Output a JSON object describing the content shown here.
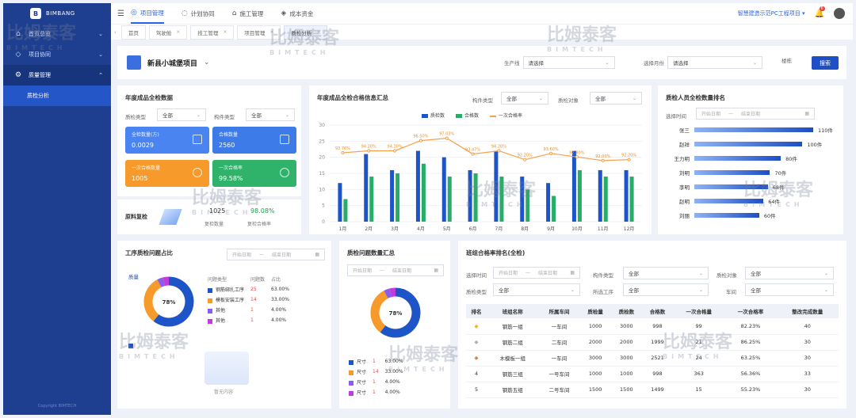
{
  "sidebar": {
    "logo": "BIMBANG",
    "items": [
      {
        "label": "首页总览",
        "icon": "home-icon"
      },
      {
        "label": "项目协同",
        "icon": "collab-icon"
      },
      {
        "label": "质量管理",
        "icon": "gear-icon"
      }
    ],
    "sub_items": [
      {
        "label": "质检分析"
      }
    ],
    "footer": "Copyright BIMTECH"
  },
  "topbar": {
    "nav": [
      {
        "label": "项目管理",
        "icon": "project-icon",
        "active": true
      },
      {
        "label": "计划协同",
        "icon": "plan-icon",
        "active": false
      },
      {
        "label": "施工管理",
        "icon": "construction-icon",
        "active": false
      },
      {
        "label": "成本资金",
        "icon": "cost-icon",
        "active": false
      }
    ],
    "project_selector": "智慧建造示范PC工程项目 ▾",
    "notification_count": "6"
  },
  "tabs": [
    {
      "label": "首页",
      "active": false
    },
    {
      "label": "驾驶舱",
      "active": false
    },
    {
      "label": "技工管理",
      "active": false
    },
    {
      "label": "项目管理",
      "active": false
    },
    {
      "label": "质检分析",
      "active": true
    }
  ],
  "filter": {
    "project_title": "新县小城堡项目",
    "field1_label": "生产线",
    "field1_value": "请选择",
    "field2_label": "选择月份",
    "field2_value": "请选择",
    "field3_label": "楼栋",
    "search_label": "搜索"
  },
  "annual": {
    "title": "年度成品全检数据",
    "f1_label": "质检类型",
    "f1_value": "全部",
    "f2_label": "构件类型",
    "f2_value": "全部",
    "kpis": [
      {
        "label": "全检数量(方)",
        "value": "0.0029",
        "color": "#4a84f0"
      },
      {
        "label": "合格数量",
        "value": "2560",
        "color": "#3d7be8"
      },
      {
        "label": "一次合格数量",
        "value": "1005",
        "color": "#f59a2b"
      },
      {
        "label": "一次合格率",
        "value": "99.58%",
        "color": "#2fb36a"
      }
    ],
    "raw_label": "原料复检",
    "raw_count": "1025",
    "raw_count_label": "复检数量",
    "raw_rate": "98.08%",
    "raw_rate_label": "复检合格率"
  },
  "combo": {
    "title": "年度成品全检合格信息汇总",
    "f1_label": "构件类型",
    "f1_value": "全部",
    "f2_label": "质检对象",
    "f2_value": "全部"
  },
  "chart_data": {
    "type": "bar",
    "categories": [
      "1月",
      "2月",
      "3月",
      "4月",
      "5月",
      "6月",
      "7月",
      "8月",
      "9月",
      "10月",
      "11月",
      "12月"
    ],
    "series": [
      {
        "name": "质检数",
        "values": [
          12,
          21,
          16,
          22,
          20,
          16,
          22,
          14,
          12,
          22,
          16,
          16
        ],
        "color": "#1d54c7"
      },
      {
        "name": "合格数",
        "values": [
          7,
          14,
          15,
          18,
          14,
          15,
          14,
          10,
          8,
          16,
          14,
          14
        ],
        "color": "#27ad67"
      },
      {
        "name": "一次合格率",
        "values": [
          93.76,
          94.2,
          94.2,
          96.5,
          97.03,
          93.47,
          94.2,
          92.2,
          93.6,
          92.8,
          92,
          92.2
        ],
        "color": "#f4a04a"
      }
    ],
    "point_labels": [
      "93.76%",
      "94.20%",
      "94.20%",
      "96.50%",
      "97.03%",
      "93.47%",
      "94.20%",
      "92.20%",
      "93.60%",
      "92.80%",
      "92.00%",
      "92.20%"
    ],
    "yticks": [
      "0",
      "5",
      "10",
      "15",
      "20",
      "25",
      "30"
    ],
    "ylim": [
      0,
      30
    ],
    "rate_range": [
      80,
      100
    ],
    "legend": "top"
  },
  "personnel": {
    "title": "质检人员全检数量排名",
    "date_label": "选择时间",
    "date_start": "开始日期",
    "date_end": "结束日期",
    "rows": [
      {
        "name": "张三",
        "value": 110,
        "label": "110件"
      },
      {
        "name": "赵祥",
        "value": 100,
        "label": "100件"
      },
      {
        "name": "王力明",
        "value": 80,
        "label": "80件"
      },
      {
        "name": "刘明",
        "value": 70,
        "label": "70件"
      },
      {
        "name": "李明",
        "value": 68,
        "label": "68件"
      },
      {
        "name": "赵明",
        "value": 64,
        "label": "64件"
      },
      {
        "name": "刘丽",
        "value": 60,
        "label": "60件"
      }
    ]
  },
  "process": {
    "title": "工序质检问题占比",
    "date_start": "开始日期",
    "date_end": "结束日期",
    "donut_label": "质量",
    "donut_center": "78%",
    "headers": [
      "问题类型",
      "问题数",
      "占比"
    ],
    "rows": [
      {
        "name": "钢筋绑扎工序",
        "count": "25",
        "pct": "63.00%",
        "value": 63,
        "color": "#1d54c7"
      },
      {
        "name": "模板安装工序",
        "count": "14",
        "pct": "33.00%",
        "value": 33,
        "color": "#f59a2b"
      },
      {
        "name": "其他",
        "count": "1",
        "pct": "4.00%",
        "value": 4,
        "color": "#8a5cf0"
      },
      {
        "name": "其他",
        "count": "1",
        "pct": "4.00%",
        "value": 4,
        "color": "#c13cd8"
      }
    ],
    "empty_text": "暂无内容",
    "bottom_legend_color": "#1d54c7"
  },
  "defects": {
    "title": "质检问题数量汇总",
    "date_start": "开始日期",
    "date_end": "结束日期",
    "donut_center": "78%",
    "rows": [
      {
        "name": "尺寸",
        "count": "1",
        "pct": "63.00%",
        "value": 63,
        "color": "#1d54c7"
      },
      {
        "name": "尺寸",
        "count": "14",
        "pct": "33.00%",
        "value": 33,
        "color": "#f59a2b"
      },
      {
        "name": "尺寸",
        "count": "1",
        "pct": "4.00%",
        "value": 4,
        "color": "#8a5cf0"
      },
      {
        "name": "尺寸",
        "count": "1",
        "pct": "4.00%",
        "value": 4,
        "color": "#c13cd8"
      }
    ]
  },
  "ranking": {
    "title": "班组合格率排名(全检)",
    "filters": {
      "time_label": "选择时间",
      "date_start": "开始日期",
      "date_end": "结束日期",
      "comp_label": "构件类型",
      "comp_value": "全部",
      "obj_label": "质检对象",
      "obj_value": "全部",
      "type_label": "质检类型",
      "type_value": "全部",
      "proc_label": "所选工序",
      "proc_value": "全部",
      "line_label": "车间",
      "line_value": "全部"
    },
    "headers": [
      "排名",
      "班组名称",
      "所属车间",
      "质检量",
      "质检数",
      "合格数",
      "一次合格量",
      "一次合格率",
      "整改完成数量"
    ],
    "rows": [
      {
        "rank": "1",
        "team": "钢筋一组",
        "shop": "一车间",
        "q1": "1000",
        "q2": "3000",
        "pass": "998",
        "first": "99",
        "rate": "82.23%",
        "fix": "40"
      },
      {
        "rank": "2",
        "team": "钢筋二组",
        "shop": "二车间",
        "q1": "2000",
        "q2": "2000",
        "pass": "1999",
        "first": "21",
        "rate": "86.25%",
        "fix": "30"
      },
      {
        "rank": "3",
        "team": "木模板一组",
        "shop": "一车间",
        "q1": "3000",
        "q2": "3000",
        "pass": "2521",
        "first": "24",
        "rate": "63.25%",
        "fix": "30"
      },
      {
        "rank": "4",
        "team": "钢筋三组",
        "shop": "一号车间",
        "q1": "1000",
        "q2": "1000",
        "pass": "998",
        "first": "363",
        "rate": "56.36%",
        "fix": "33"
      },
      {
        "rank": "5",
        "team": "钢筋五组",
        "shop": "二号车间",
        "q1": "1500",
        "q2": "1500",
        "pass": "1499",
        "first": "15",
        "rate": "55.23%",
        "fix": "30"
      }
    ]
  },
  "watermark": {
    "cn": "比姆泰客",
    "en": "BIMTECH"
  }
}
